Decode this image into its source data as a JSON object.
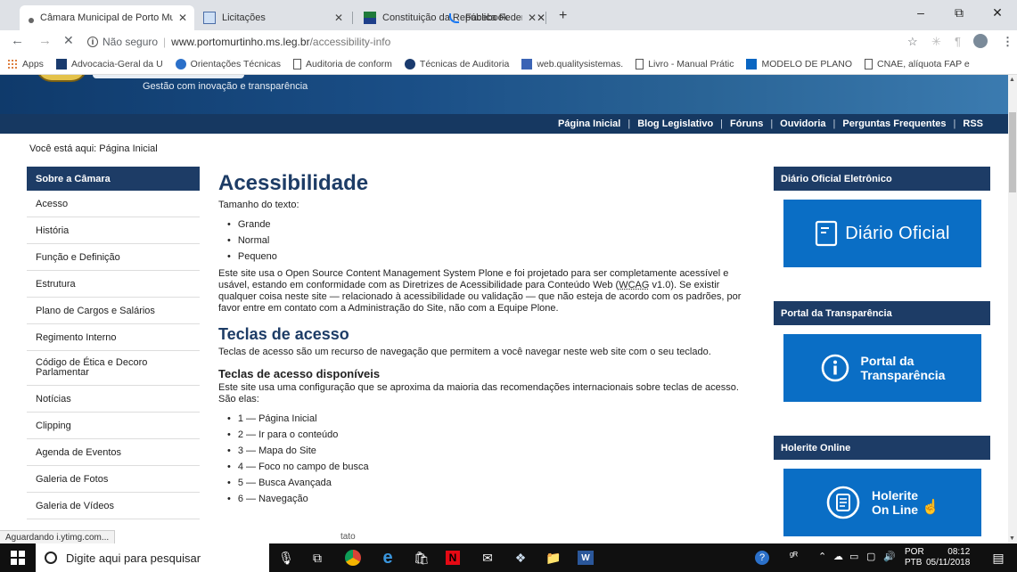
{
  "browser": {
    "tabs": [
      {
        "title": "Câmara Municipal de Porto Murti",
        "active": true
      },
      {
        "title": "Licitações",
        "active": false
      },
      {
        "title": "Constituição da República Federa",
        "active": false
      },
      {
        "title": "Facebook",
        "active": false
      }
    ],
    "new_tab": "+",
    "window_controls": {
      "minimize": "–",
      "maximize": "⧉",
      "close": "✕"
    },
    "address": {
      "not_secure": "Não seguro",
      "domain": "www.portomurtinho.ms.leg.br",
      "path": "/accessibility-info"
    },
    "bookmarks": [
      {
        "label": "Apps",
        "icon": "apps-icon"
      },
      {
        "label": "Advocacia-Geral da U",
        "icon": "agu-icon"
      },
      {
        "label": "Orientações Técnicas",
        "icon": "globe-icon"
      },
      {
        "label": "Auditoria de conform",
        "icon": "page-icon"
      },
      {
        "label": "Técnicas de Auditoria",
        "icon": "site-icon"
      },
      {
        "label": "web.qualitysistemas.",
        "icon": "web-icon"
      },
      {
        "label": "Livro - Manual Prátic",
        "icon": "page-icon"
      },
      {
        "label": "MODELO DE PLANO",
        "icon": "linkedin-icon"
      },
      {
        "label": "CNAE, alíquota FAP e",
        "icon": "page-icon"
      }
    ]
  },
  "site": {
    "slogan": "Gestão com inovação e transparência",
    "topnav": [
      "Página Inicial",
      "Blog Legislativo",
      "Fóruns",
      "Ouvidoria",
      "Perguntas Frequentes",
      "RSS"
    ],
    "breadcrumb": "Você está aqui: Página Inicial",
    "sidebar": {
      "title": "Sobre a Câmara",
      "items": [
        "Acesso",
        "História",
        "Função e Definição",
        "Estrutura",
        "Plano de Cargos e Salários",
        "Regimento Interno",
        "Código de Ética e Decoro Parlamentar",
        "Notícias",
        "Clipping",
        "Agenda de Eventos",
        "Galeria de Fotos",
        "Galeria de Vídeos"
      ]
    },
    "main": {
      "title": "Acessibilidade",
      "text_size_label": "Tamanho do texto:",
      "text_sizes": [
        "Grande",
        "Normal",
        "Pequeno"
      ],
      "intro_1": "Este site usa o ",
      "intro_link1": "Open Source Content Management System Plone",
      "intro_2": " e foi projetado para ser completamente acessível e usável, estando em conformidade com as ",
      "intro_link2": "Diretrizes de Acessibilidade para Conteúdo Web",
      "intro_3": " (",
      "intro_abbr": "WCAG",
      "intro_4": " v1.0). Se existir qualquer coisa neste site — relacionado à acessibilidade ou validação — que não esteja de acordo com os padrões, por favor entre em contato com a ",
      "intro_link3": "Administração do Site",
      "intro_5": ", não com a ",
      "intro_link4": "Equipe Plone",
      "intro_6": ".",
      "keys_title": "Teclas de acesso",
      "keys_text": "Teclas de acesso são um recurso de navegação que permitem a você navegar neste web site com o seu teclado.",
      "keys_avail_title": "Teclas de acesso disponíveis",
      "keys_avail_text": "Este site usa uma configuração que se aproxima da maioria das recomendações internacionais sobre teclas de acesso. São elas:",
      "keys_list": [
        "1 — Página Inicial",
        "2 — Ir para o conteúdo",
        "3 — Mapa do Site",
        "4 — Foco no campo de busca",
        "5 — Busca Avançada",
        "6 — Navegação"
      ]
    },
    "right": {
      "blocks": [
        {
          "title": "Diário Oficial Eletrônico",
          "button": "Diário Oficial"
        },
        {
          "title": "Portal da Transparência",
          "button_line1": "Portal da",
          "button_line2": "Transparência"
        },
        {
          "title": "Holerite Online",
          "button_line1": "Holerite",
          "button_line2": "On Line"
        }
      ]
    }
  },
  "status_bar": "Aguardando i.ytimg.com...",
  "status_tail": "tato",
  "taskbar": {
    "search_placeholder": "Digite aqui para pesquisar",
    "lang_line1": "POR",
    "lang_line2": "PTB",
    "time": "08:12",
    "date": "05/11/2018"
  }
}
